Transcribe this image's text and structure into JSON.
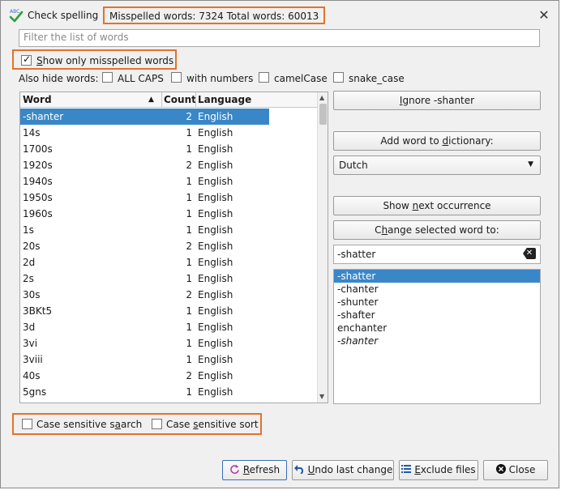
{
  "title": "Check spelling",
  "summary": "Misspelled words: 7324 Total words: 60013",
  "filter_placeholder": "Filter the list of words",
  "show_only_misspelled": "Show only misspelled words",
  "also_hide_label": "Also hide words:",
  "hide_options": [
    "ALL CAPS",
    "with numbers",
    "camelCase",
    "snake_case"
  ],
  "table": {
    "headers": {
      "word": "Word",
      "count": "Count",
      "language": "Language"
    },
    "rows": [
      {
        "word": "-shanter",
        "count": "2",
        "language": "English"
      },
      {
        "word": "14s",
        "count": "1",
        "language": "English"
      },
      {
        "word": "1700s",
        "count": "1",
        "language": "English"
      },
      {
        "word": "1920s",
        "count": "2",
        "language": "English"
      },
      {
        "word": "1940s",
        "count": "1",
        "language": "English"
      },
      {
        "word": "1950s",
        "count": "1",
        "language": "English"
      },
      {
        "word": "1960s",
        "count": "1",
        "language": "English"
      },
      {
        "word": "1s",
        "count": "1",
        "language": "English"
      },
      {
        "word": "20s",
        "count": "2",
        "language": "English"
      },
      {
        "word": "2d",
        "count": "1",
        "language": "English"
      },
      {
        "word": "2s",
        "count": "1",
        "language": "English"
      },
      {
        "word": "30s",
        "count": "2",
        "language": "English"
      },
      {
        "word": "3BKt5",
        "count": "1",
        "language": "English"
      },
      {
        "word": "3d",
        "count": "1",
        "language": "English"
      },
      {
        "word": "3vi",
        "count": "1",
        "language": "English"
      },
      {
        "word": "3viii",
        "count": "1",
        "language": "English"
      },
      {
        "word": "40s",
        "count": "2",
        "language": "English"
      },
      {
        "word": "5gns",
        "count": "1",
        "language": "English"
      }
    ]
  },
  "buttons": {
    "ignore": "Ignore -shanter",
    "add_word": "Add word to dictionary:",
    "show_next": "Show next occurrence",
    "change_word": "Change selected word to:",
    "refresh": "Refresh",
    "undo": "Undo last change",
    "exclude": "Exclude files",
    "close": "Close"
  },
  "dictionary_selected": "Dutch",
  "replacement_value": "-shatter",
  "suggestions": [
    "-shatter",
    "-chanter",
    "-shunter",
    "-shafter",
    "enchanter",
    "-shanter"
  ],
  "case_sensitive_search": "Case sensitive search",
  "case_sensitive_sort": "Case sensitive sort",
  "colors": {
    "accent_highlight": "#e0742a",
    "selection": "#3a87c8"
  }
}
